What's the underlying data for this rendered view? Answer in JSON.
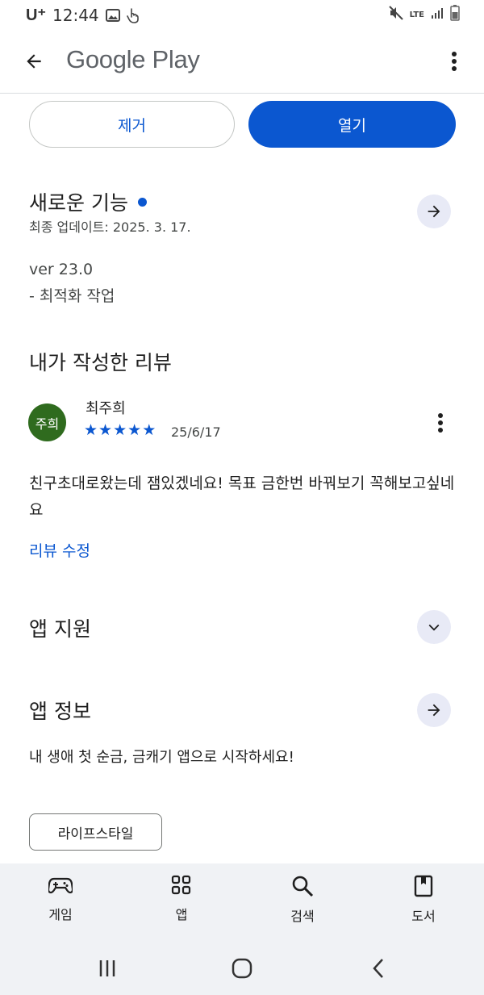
{
  "status_bar": {
    "carrier": "U⁺",
    "time": "12:44",
    "network": "LTE"
  },
  "app_bar": {
    "title": "Google Play"
  },
  "actions": {
    "uninstall_label": "제거",
    "open_label": "열기"
  },
  "whats_new": {
    "title": "새로운 기능",
    "last_updated": "최종 업데이트: 2025. 3. 17.",
    "version": "ver 23.0",
    "note": "- 최적화 작업"
  },
  "my_review": {
    "title": "내가 작성한 리뷰",
    "avatar_text": "주희",
    "reviewer": "최주희",
    "rating": 5,
    "date": "25/6/17",
    "text": "친구초대로왔는데 잼있겠네요! 목표 금한번 바꿔보기 꼭해보고싶네요",
    "edit_label": "리뷰 수정"
  },
  "app_support": {
    "title": "앱 지원"
  },
  "app_info": {
    "title": "앱 정보",
    "description": "내 생애 첫 순금, 금캐기 앱으로 시작하세요!",
    "category": "라이프스타일"
  },
  "bottom_nav": {
    "items": [
      {
        "label": "게임",
        "icon": "gamepad-icon"
      },
      {
        "label": "앱",
        "icon": "apps-grid-icon"
      },
      {
        "label": "검색",
        "icon": "search-icon"
      },
      {
        "label": "도서",
        "icon": "book-icon"
      }
    ]
  },
  "colors": {
    "accent": "#0b57d0",
    "avatar_bg": "#2f6b1e",
    "nav_bg": "#f0f2f5"
  }
}
